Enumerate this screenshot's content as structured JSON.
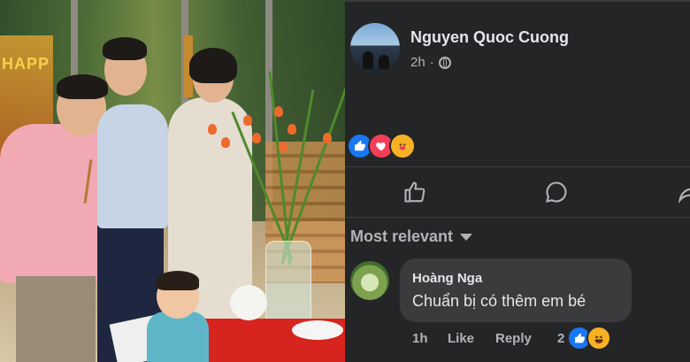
{
  "photo": {
    "sign_text": "HAPP",
    "description_icons": [
      "photo"
    ]
  },
  "post": {
    "author_name": "Nguyen Quoc Cuong",
    "time": "2h",
    "privacy_icon": "globe-icon",
    "reactions": [
      "like-icon",
      "love-icon",
      "care-icon"
    ]
  },
  "actions": {
    "icons": [
      "like-outline-icon",
      "comment-icon",
      "share-icon"
    ]
  },
  "comments": {
    "sort_label": "Most relevant",
    "items": [
      {
        "author": "Hoàng Nga",
        "text": "Chuẩn bị có thêm em bé",
        "time": "1h",
        "like_label": "Like",
        "reply_label": "Reply",
        "reaction_count": "2",
        "reactions": [
          "like-icon",
          "haha-icon"
        ]
      }
    ]
  },
  "colors": {
    "panel_bg": "#242526",
    "bubble_bg": "#3a3b3c",
    "text_primary": "#e4e6eb",
    "text_secondary": "#b0b3b8",
    "like_blue": "#1877f2",
    "love_red": "#f33e58",
    "care_yellow": "#f7b125"
  }
}
